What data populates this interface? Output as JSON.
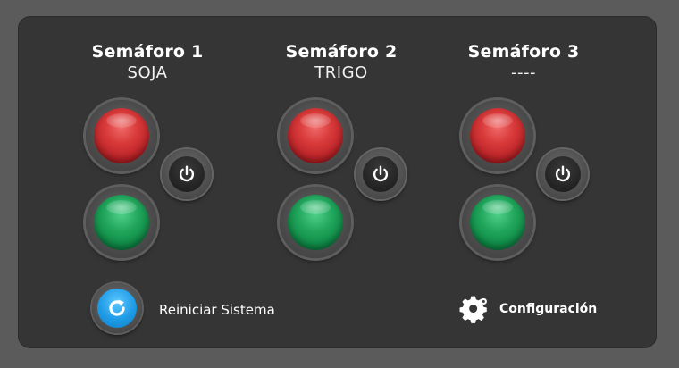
{
  "semaforos": [
    {
      "title": "Semáforo 1",
      "crop": "SOJA"
    },
    {
      "title": "Semáforo 2",
      "crop": "TRIGO"
    },
    {
      "title": "Semáforo 3",
      "crop": "----"
    }
  ],
  "icons": {
    "light_red": "red-light-icon",
    "light_green": "green-light-icon",
    "power": "power-icon",
    "reset": "refresh-icon",
    "config": "gear-icon"
  },
  "actions": {
    "reset_label": "Reiniciar Sistema",
    "config_label": "Configuración"
  },
  "colors": {
    "background": "#5b5b5b",
    "panel": "#353535",
    "red": "#d93a3a",
    "green": "#1fa45a",
    "accent_blue": "#1e9be6"
  }
}
